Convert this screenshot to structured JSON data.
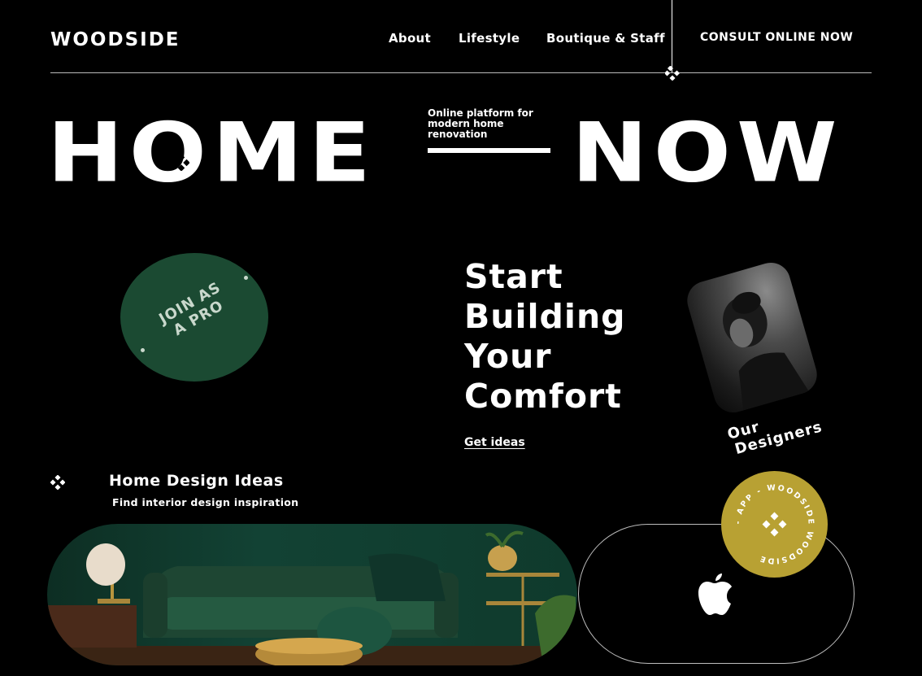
{
  "header": {
    "logo": "WOODSIDE",
    "nav": [
      "About",
      "Lifestyle",
      "Boutique & Staff"
    ],
    "cta": "CONSULT ONLINE NOW"
  },
  "hero": {
    "word_left": "HOME",
    "word_right": "NOW",
    "tagline": "Online platform for modern home renovation"
  },
  "pro_badge": {
    "line1": "JOIN AS",
    "line2": "A PRO"
  },
  "headline": {
    "lines": [
      "Start",
      "Building",
      "Your",
      "Comfort"
    ],
    "link": "Get ideas"
  },
  "designers": {
    "line1": "Our",
    "line2": "Designers"
  },
  "ideas": {
    "title": "Home Design Ideas",
    "subtitle": "Find interior design inspiration"
  },
  "app": {
    "badge_text": "- APP - WOODSIDE WOODSIDE",
    "icon": "apple-icon"
  },
  "colors": {
    "background": "#000000",
    "accent_green": "#1b4a32",
    "accent_gold": "#b8a133"
  }
}
